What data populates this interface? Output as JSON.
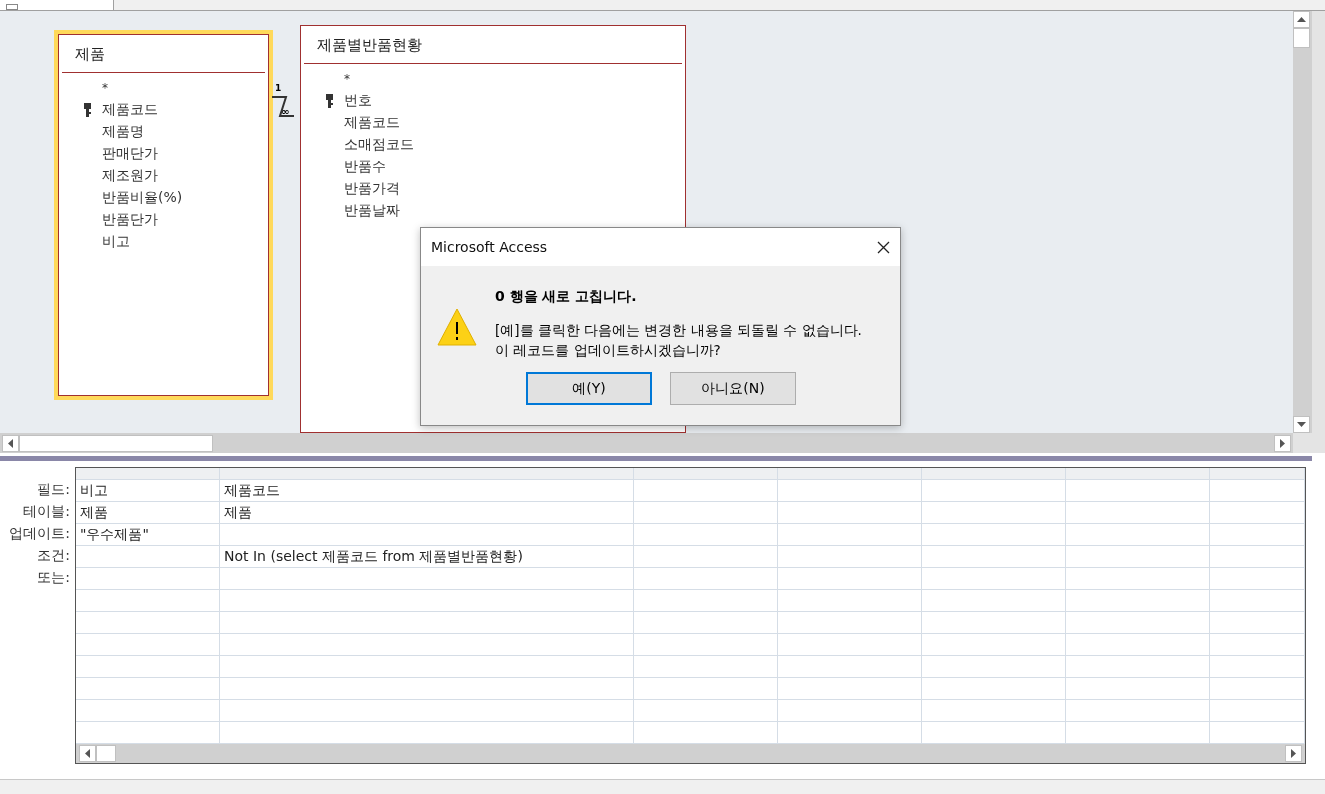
{
  "tables": [
    {
      "name": "제품",
      "selected": true,
      "fields": [
        {
          "name": "*",
          "key": false
        },
        {
          "name": "제품코드",
          "key": true
        },
        {
          "name": "제품명",
          "key": false
        },
        {
          "name": "판매단가",
          "key": false
        },
        {
          "name": "제조원가",
          "key": false
        },
        {
          "name": "반품비율(%)",
          "key": false
        },
        {
          "name": "반품단가",
          "key": false
        },
        {
          "name": "비고",
          "key": false
        }
      ]
    },
    {
      "name": "제품별반품현황",
      "selected": false,
      "fields": [
        {
          "name": "*",
          "key": false
        },
        {
          "name": "번호",
          "key": true
        },
        {
          "name": "제품코드",
          "key": false
        },
        {
          "name": "소매점코드",
          "key": false
        },
        {
          "name": "반품수",
          "key": false
        },
        {
          "name": "반품가격",
          "key": false
        },
        {
          "name": "반품날짜",
          "key": false
        }
      ]
    }
  ],
  "relationship": {
    "one_label": "1",
    "many_label": "∞"
  },
  "dialog": {
    "title": "Microsoft Access",
    "heading": "0 행을 새로 고칩니다.",
    "message": [
      "[예]를 클릭한 다음에는 변경한 내용을 되돌릴 수 없습니다.",
      "이 레코드를 업데이트하시겠습니까?"
    ],
    "buttons": [
      {
        "label": "예(Y)",
        "selected": true
      },
      {
        "label": "아니요(N)",
        "selected": false
      }
    ]
  },
  "grid": {
    "row_labels": [
      "필드:",
      "테이블:",
      "업데이트:",
      "조건:",
      "또는:"
    ],
    "columns": [
      {
        "field": "비고",
        "table": "제품",
        "update": "\"우수제품\""
      },
      {
        "field": "제품코드",
        "table": "제품",
        "criteria": "Not In (select 제품코드 from 제품별반품현황)"
      }
    ]
  }
}
